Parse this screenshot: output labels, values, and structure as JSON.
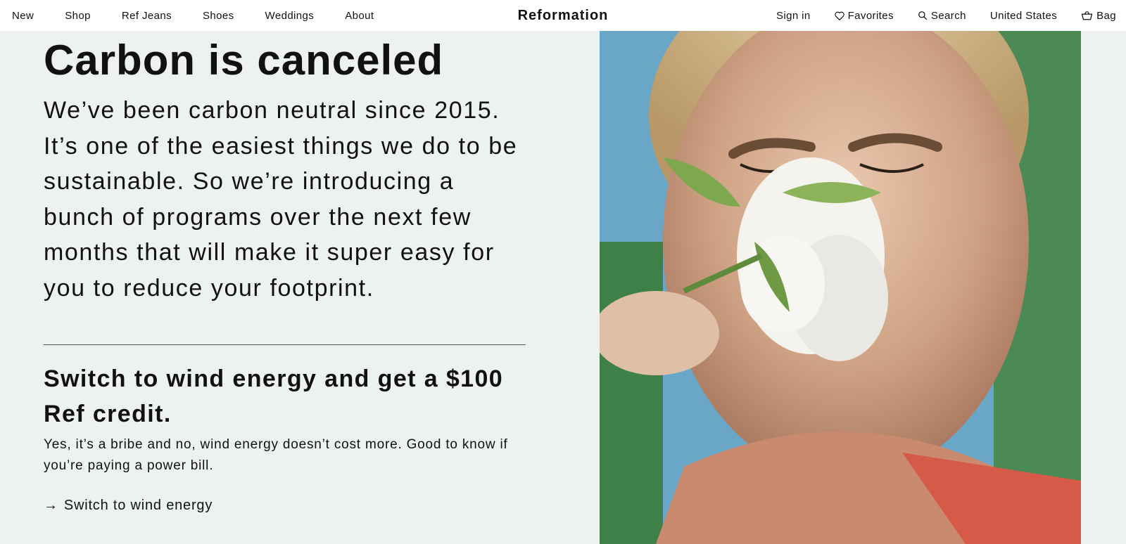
{
  "nav": {
    "left_items": [
      "New",
      "Shop",
      "Ref Jeans",
      "Shoes",
      "Weddings",
      "About"
    ],
    "brand": "Reformation",
    "sign_in": "Sign in",
    "favorites": "Favorites",
    "search": "Search",
    "region": "United States",
    "bag": "Bag"
  },
  "content": {
    "headline": "Carbon is canceled",
    "intro": "We’ve been carbon neutral since 2015. It’s one of the easiest things we do to be sustainable. So we’re introducing a bunch of programs over the next few months that will make it super easy for you to reduce your footprint.",
    "sub_heading": "Switch to wind energy and get a $100 Ref credit.",
    "sub_body": "Yes, it’s a bribe and no, wind energy doesn’t cost more. Good to know if you’re paying a power bill.",
    "cta_arrow": "→",
    "cta_label": "Switch to wind energy"
  },
  "icons": {
    "favorites": "heart-icon",
    "search": "search-icon",
    "bag": "bag-icon"
  }
}
